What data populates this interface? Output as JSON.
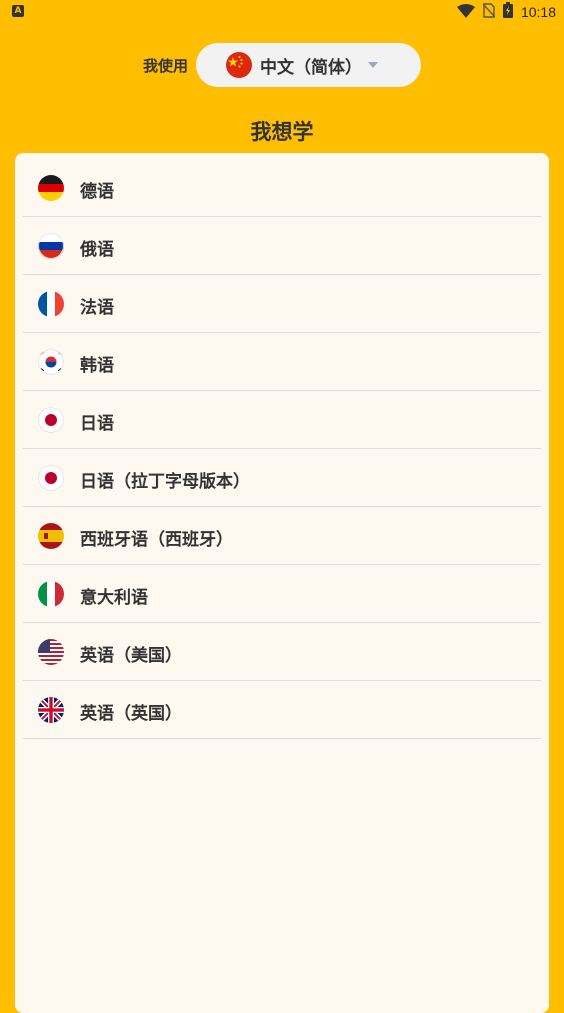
{
  "status_bar": {
    "time": "10:18",
    "left_icon": "notification-a-icon",
    "icons": [
      "wifi-icon",
      "no-sim-icon",
      "battery-charging-icon"
    ]
  },
  "source": {
    "label": "我使用",
    "language": "中文（简体）",
    "flag": "china-flag-icon"
  },
  "title": "我想学",
  "languages": [
    {
      "label": "德语",
      "flag": "germany-flag-icon"
    },
    {
      "label": "俄语",
      "flag": "russia-flag-icon"
    },
    {
      "label": "法语",
      "flag": "france-flag-icon"
    },
    {
      "label": "韩语",
      "flag": "south-korea-flag-icon"
    },
    {
      "label": "日语",
      "flag": "japan-flag-icon"
    },
    {
      "label": "日语（拉丁字母版本）",
      "flag": "japan-flag-icon"
    },
    {
      "label": "西班牙语（西班牙）",
      "flag": "spain-flag-icon"
    },
    {
      "label": "意大利语",
      "flag": "italy-flag-icon"
    },
    {
      "label": "英语（美国）",
      "flag": "usa-flag-icon"
    },
    {
      "label": "英语（英国）",
      "flag": "uk-flag-icon"
    }
  ],
  "colors": {
    "background": "#FFBF00",
    "card": "#FDF9F1",
    "text": "#333333"
  }
}
